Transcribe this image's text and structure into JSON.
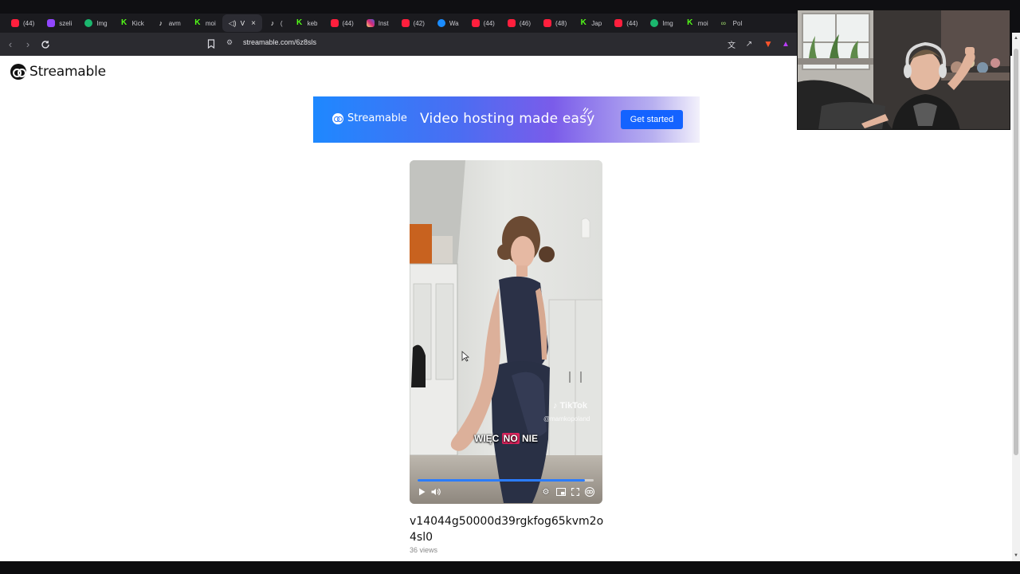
{
  "tabs": [
    {
      "label": "(44)",
      "icon": "youtube",
      "active": false
    },
    {
      "label": "szeli",
      "icon": "twitch",
      "active": false
    },
    {
      "label": "Img",
      "icon": "imgur",
      "active": false
    },
    {
      "label": "Kick",
      "icon": "kick",
      "active": false
    },
    {
      "label": "avm",
      "icon": "tiktok",
      "active": false
    },
    {
      "label": "moi",
      "icon": "kick",
      "active": false
    },
    {
      "label": "V",
      "icon": "sound",
      "active": true
    },
    {
      "label": "(",
      "icon": "tiktok",
      "active": false
    },
    {
      "label": "keb",
      "icon": "kick",
      "active": false
    },
    {
      "label": "(44)",
      "icon": "youtube",
      "active": false
    },
    {
      "label": "Inst",
      "icon": "instagram",
      "active": false
    },
    {
      "label": "(42)",
      "icon": "youtube",
      "active": false
    },
    {
      "label": "Wa",
      "icon": "streamable",
      "active": false
    },
    {
      "label": "(44)",
      "icon": "youtube",
      "active": false
    },
    {
      "label": "(46)",
      "icon": "youtube",
      "active": false
    },
    {
      "label": "(48)",
      "icon": "youtube",
      "active": false
    },
    {
      "label": "Jap",
      "icon": "kick",
      "active": false
    },
    {
      "label": "(44)",
      "icon": "youtube",
      "active": false
    },
    {
      "label": "Img",
      "icon": "imgur",
      "active": false
    },
    {
      "label": "moi",
      "icon": "kick",
      "active": false
    },
    {
      "label": "Pol",
      "icon": "link",
      "active": false
    }
  ],
  "toolbar": {
    "url": "streamable.com/6z8sls",
    "back_icon": "chevron-left-icon",
    "forward_icon": "chevron-right-icon",
    "reload_icon": "reload-icon"
  },
  "header": {
    "logo_text": "Streamable"
  },
  "banner": {
    "brand": "Streamable",
    "tagline": "Video hosting made easy",
    "cta_label": "Get started"
  },
  "player": {
    "watermark": "TikTok",
    "watermark_handle": "@mamkopoland",
    "caption_before": "WIĘC ",
    "caption_highlight": "NO",
    "caption_after": " NIE",
    "progress": 0.95,
    "accent_color": "#2b7cff"
  },
  "video": {
    "title": "v14044g50000d39rgkfog65kvm2o4sl0",
    "views": "36 views"
  }
}
